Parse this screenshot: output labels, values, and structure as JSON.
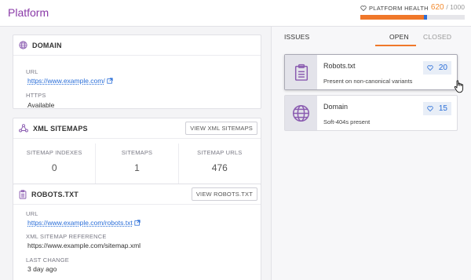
{
  "app": {
    "title": "Platform"
  },
  "health": {
    "label": "PLATFORM HEALTH",
    "value": "620",
    "max": "/ 1000",
    "fraction": 0.62,
    "icon": "heart-outline-icon",
    "color_fill": "#f0782a",
    "color_marker": "#2f6fd6"
  },
  "domain_card": {
    "title": "DOMAIN",
    "icon": "globe-icon",
    "url_label": "URL",
    "url": "https://www.example.com/",
    "https_label": "HTTPS",
    "https_value": "Available"
  },
  "sitemaps_card": {
    "title": "XML SITEMAPS",
    "icon": "sitemap-icon",
    "button": "VIEW XML SITEMAPS",
    "stats": [
      {
        "label": "SITEMAP INDEXES",
        "value": "0"
      },
      {
        "label": "SITEMAPS",
        "value": "1"
      },
      {
        "label": "SITEMAP URLS",
        "value": "476"
      }
    ]
  },
  "robots_card": {
    "title": "ROBOTS.TXT",
    "icon": "clipboard-icon",
    "button": "VIEW ROBOTS.TXT",
    "url_label": "URL",
    "url": "https://www.example.com/robots.txt",
    "sitemap_ref_label": "XML SITEMAP REFERENCE",
    "sitemap_ref": "https://www.example.com/sitemap.xml",
    "last_change_label": "LAST CHANGE",
    "last_change": "3 day ago"
  },
  "issues": {
    "label": "ISSUES",
    "tabs": [
      {
        "label": "OPEN"
      },
      {
        "label": "CLOSED"
      }
    ],
    "items": [
      {
        "name": "Robots.txt",
        "desc": "Present on non-canonical variants",
        "count": "20",
        "icon": "clipboard-icon"
      },
      {
        "name": "Domain",
        "desc": "Soft-404s present",
        "count": "15",
        "icon": "globe-icon"
      }
    ]
  }
}
